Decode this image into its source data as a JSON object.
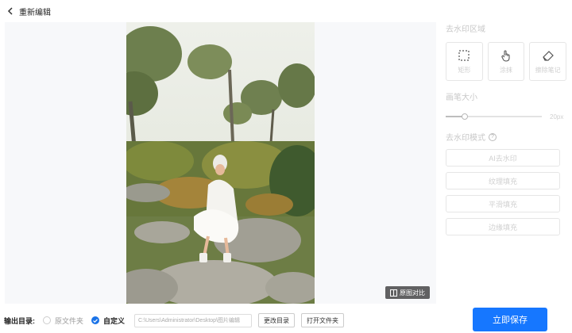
{
  "header": {
    "title": "重新编辑"
  },
  "preview": {
    "compare_label": "原图对比"
  },
  "panel": {
    "region_title": "去水印区域",
    "tools": [
      {
        "label": "矩形",
        "icon": "rectangle-select-icon"
      },
      {
        "label": "涂抹",
        "icon": "hand-pointer-icon"
      },
      {
        "label": "擦除笔记",
        "icon": "eraser-icon"
      }
    ],
    "brush_title": "画笔大小",
    "brush_value": "20px",
    "brush_level": 0.2,
    "mode_title": "去水印模式",
    "modes": [
      "AI去水印",
      "纹理填充",
      "平滑填充",
      "边缘填充"
    ]
  },
  "footer": {
    "output_label": "输出目录:",
    "option_original": "原文件夹",
    "option_custom": "自定义",
    "path_value": "C:\\Users\\Administrator\\Desktop\\图片编辑",
    "change_dir_label": "更改目录",
    "open_folder_label": "打开文件夹",
    "save_label": "立即保存"
  },
  "colors": {
    "primary": "#1677ff",
    "panel_muted_text": "#d0d0d0"
  }
}
